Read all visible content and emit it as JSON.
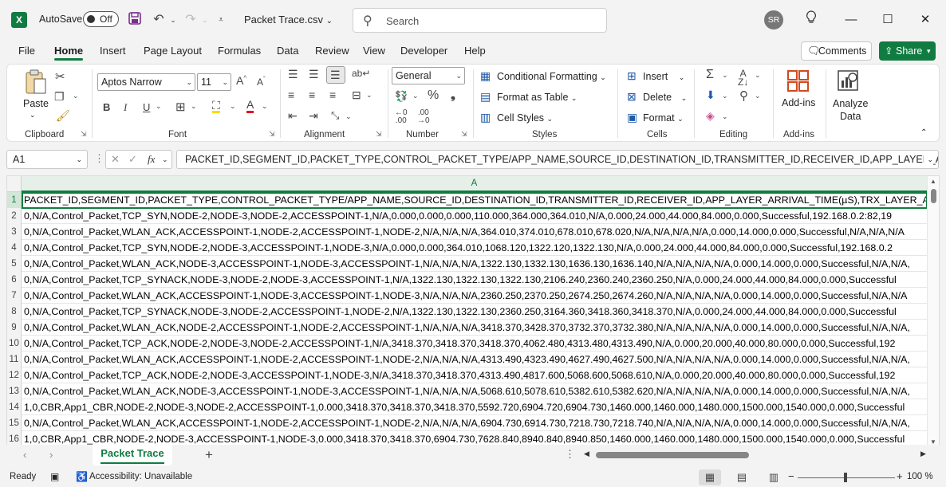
{
  "title_bar": {
    "app_icon": "X",
    "autosave_label": "AutoSave",
    "autosave_state": "Off",
    "file_name": "Packet Trace.csv",
    "search_placeholder": "Search",
    "user_initials": "SR"
  },
  "ribbon_tabs": [
    "File",
    "Home",
    "Insert",
    "Page Layout",
    "Formulas",
    "Data",
    "Review",
    "View",
    "Developer",
    "Help"
  ],
  "active_tab": "Home",
  "header_actions": {
    "comments": "Comments",
    "share": "Share"
  },
  "ribbon": {
    "clipboard": {
      "label": "Clipboard",
      "paste": "Paste"
    },
    "font": {
      "label": "Font",
      "font_name": "Aptos Narrow",
      "font_size": "11"
    },
    "alignment": {
      "label": "Alignment"
    },
    "number": {
      "label": "Number",
      "format": "General"
    },
    "styles": {
      "label": "Styles",
      "conditional_formatting": "Conditional Formatting",
      "format_as_table": "Format as Table",
      "cell_styles": "Cell Styles"
    },
    "cells": {
      "label": "Cells",
      "insert": "Insert",
      "delete": "Delete",
      "format": "Format"
    },
    "editing": {
      "label": "Editing"
    },
    "addins": {
      "label": "Add-ins",
      "button": "Add-ins"
    },
    "analyze": {
      "line1": "Analyze",
      "line2": "Data"
    }
  },
  "formula_bar": {
    "name_box": "A1",
    "fx": "fx",
    "content": "PACKET_ID,SEGMENT_ID,PACKET_TYPE,CONTROL_PACKET_TYPE/APP_NAME,SOURCE_ID,DESTINATION_ID,TRANSMITTER_ID,RECEIVER_ID,APP_LAYER_ARRI"
  },
  "grid": {
    "column_header": "A",
    "rows": [
      {
        "n": "1",
        "text": "PACKET_ID,SEGMENT_ID,PACKET_TYPE,CONTROL_PACKET_TYPE/APP_NAME,SOURCE_ID,DESTINATION_ID,TRANSMITTER_ID,RECEIVER_ID,APP_LAYER_ARRIVAL_TIME(µS),TRX_LAYER_ARRIVAL_"
      },
      {
        "n": "2",
        "text": "0,N/A,Control_Packet,TCP_SYN,NODE-2,NODE-3,NODE-2,ACCESSPOINT-1,N/A,0.000,0.000,0.000,110.000,364.000,364.010,N/A,0.000,24.000,44.000,84.000,0.000,Successful,192.168.0.2:82,19"
      },
      {
        "n": "3",
        "text": "0,N/A,Control_Packet,WLAN_ACK,ACCESSPOINT-1,NODE-2,ACCESSPOINT-1,NODE-2,N/A,N/A,N/A,364.010,374.010,678.010,678.020,N/A,N/A,N/A,N/A,0.000,14.000,0.000,Successful,N/A,N/A,N/A"
      },
      {
        "n": "4",
        "text": "0,N/A,Control_Packet,TCP_SYN,NODE-2,NODE-3,ACCESSPOINT-1,NODE-3,N/A,0.000,0.000,364.010,1068.120,1322.120,1322.130,N/A,0.000,24.000,44.000,84.000,0.000,Successful,192.168.0.2"
      },
      {
        "n": "5",
        "text": "0,N/A,Control_Packet,WLAN_ACK,NODE-3,ACCESSPOINT-1,NODE-3,ACCESSPOINT-1,N/A,N/A,N/A,1322.130,1332.130,1636.130,1636.140,N/A,N/A,N/A,N/A,0.000,14.000,0.000,Successful,N/A,N/A,"
      },
      {
        "n": "6",
        "text": "0,N/A,Control_Packet,TCP_SYNACK,NODE-3,NODE-2,NODE-3,ACCESSPOINT-1,N/A,1322.130,1322.130,1322.130,2106.240,2360.240,2360.250,N/A,0.000,24.000,44.000,84.000,0.000,Successful"
      },
      {
        "n": "7",
        "text": "0,N/A,Control_Packet,WLAN_ACK,ACCESSPOINT-1,NODE-3,ACCESSPOINT-1,NODE-3,N/A,N/A,N/A,2360.250,2370.250,2674.250,2674.260,N/A,N/A,N/A,N/A,0.000,14.000,0.000,Successful,N/A,N/A"
      },
      {
        "n": "8",
        "text": "0,N/A,Control_Packet,TCP_SYNACK,NODE-3,NODE-2,ACCESSPOINT-1,NODE-2,N/A,1322.130,1322.130,2360.250,3164.360,3418.360,3418.370,N/A,0.000,24.000,44.000,84.000,0.000,Successful"
      },
      {
        "n": "9",
        "text": "0,N/A,Control_Packet,WLAN_ACK,NODE-2,ACCESSPOINT-1,NODE-2,ACCESSPOINT-1,N/A,N/A,N/A,3418.370,3428.370,3732.370,3732.380,N/A,N/A,N/A,N/A,0.000,14.000,0.000,Successful,N/A,N/A,"
      },
      {
        "n": "10",
        "text": "0,N/A,Control_Packet,TCP_ACK,NODE-2,NODE-3,NODE-2,ACCESSPOINT-1,N/A,3418.370,3418.370,3418.370,4062.480,4313.480,4313.490,N/A,0.000,20.000,40.000,80.000,0.000,Successful,192"
      },
      {
        "n": "11",
        "text": "0,N/A,Control_Packet,WLAN_ACK,ACCESSPOINT-1,NODE-2,ACCESSPOINT-1,NODE-2,N/A,N/A,N/A,4313.490,4323.490,4627.490,4627.500,N/A,N/A,N/A,N/A,0.000,14.000,0.000,Successful,N/A,N/A,"
      },
      {
        "n": "12",
        "text": "0,N/A,Control_Packet,TCP_ACK,NODE-2,NODE-3,ACCESSPOINT-1,NODE-3,N/A,3418.370,3418.370,4313.490,4817.600,5068.600,5068.610,N/A,0.000,20.000,40.000,80.000,0.000,Successful,192"
      },
      {
        "n": "13",
        "text": "0,N/A,Control_Packet,WLAN_ACK,NODE-3,ACCESSPOINT-1,NODE-3,ACCESSPOINT-1,N/A,N/A,N/A,5068.610,5078.610,5382.610,5382.620,N/A,N/A,N/A,N/A,0.000,14.000,0.000,Successful,N/A,N/A,"
      },
      {
        "n": "14",
        "text": "1,0,CBR,App1_CBR,NODE-2,NODE-3,NODE-2,ACCESSPOINT-1,0.000,3418.370,3418.370,3418.370,5592.720,6904.720,6904.730,1460.000,1460.000,1480.000,1500.000,1540.000,0.000,Successful"
      },
      {
        "n": "15",
        "text": "0,N/A,Control_Packet,WLAN_ACK,ACCESSPOINT-1,NODE-2,ACCESSPOINT-1,NODE-2,N/A,N/A,N/A,6904.730,6914.730,7218.730,7218.740,N/A,N/A,N/A,N/A,0.000,14.000,0.000,Successful,N/A,N/A,"
      },
      {
        "n": "16",
        "text": "1,0,CBR,App1_CBR,NODE-2,NODE-3,ACCESSPOINT-1,NODE-3,0.000,3418.370,3418.370,6904.730,7628.840,8940.840,8940.850,1460.000,1460.000,1480.000,1500.000,1540.000,0.000,Successful"
      }
    ]
  },
  "sheet_tabs": {
    "active": "Packet Trace"
  },
  "status_bar": {
    "ready": "Ready",
    "accessibility": "Accessibility: Unavailable",
    "zoom": "100 %"
  },
  "colors": {
    "accent": "#107c41",
    "ribbon_bg": "#ffffff",
    "window_bg": "#f3f3f3"
  }
}
